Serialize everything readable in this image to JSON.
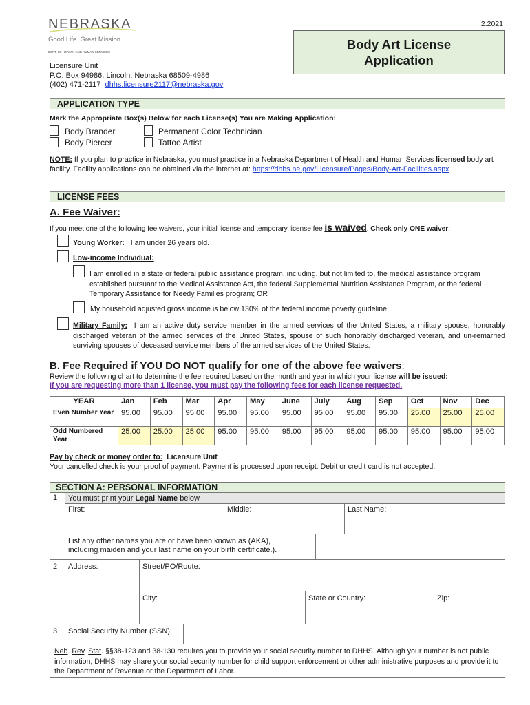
{
  "header": {
    "logo": {
      "word": "NEBRASKA",
      "tagline": "Good Life. Great Mission.",
      "dept": "DEPT. OF HEALTH AND HUMAN SERVICES"
    },
    "version": "2.2021",
    "title_line1": "Body Art License",
    "title_line2": "Application",
    "address": {
      "unit": "Licensure Unit",
      "po": "P.O. Box 94986, Lincoln, Nebraska 68509-4986",
      "phone": "(402) 471-2117",
      "email": "dhhs.licensure2117@nebraska.gov"
    },
    "colors": {
      "section_bg": "#e2efda",
      "highlight": "#fffbc7",
      "link": "#1f3fd6",
      "purple": "#7030a0"
    }
  },
  "application_type": {
    "heading": "APPLICATION TYPE",
    "instruction": "Mark the Appropriate Box(s) Below for each License(s) You are Making Application:",
    "options": [
      {
        "label": "Body Brander",
        "checked": false
      },
      {
        "label": "Body Piercer",
        "checked": false
      },
      {
        "label": "Permanent Color Technician",
        "checked": false
      },
      {
        "label": "Tattoo Artist",
        "checked": false
      }
    ],
    "note_label": "NOTE:",
    "note_text1": " If you plan to practice in Nebraska, you must practice in a Nebraska Department of Health and Human Services ",
    "note_bold": "licensed",
    "note_text2": " body art facility.  Facility applications can be obtained via the internet at:  ",
    "note_link": "https://dhhs.ne.gov/Licensure/Pages/Body-Art-Facilities.aspx"
  },
  "license_fees": {
    "heading": "LICENSE FEES",
    "waiver": {
      "title": "A.  Fee Waiver:",
      "intro": "If you meet one of the following fee waivers, your initial license and temporary license fee ",
      "intro_emph": "is waived",
      "intro_end": ".  ",
      "intro_bold": "Check only ONE waiver",
      "intro_colon": ":",
      "young_label": "Young Worker:",
      "young_text": "I am under 26 years old.",
      "low_income_label": "Low-income Individual:",
      "low_income_opt1": "I am enrolled in a state or federal public assistance program, including, but not limited to, the medical assistance program established pursuant to the Medical Assistance Act, the federal Supplemental Nutrition Assistance Program, or the federal Temporary Assistance for Needy Families program; OR",
      "low_income_opt2": "My household adjusted gross income is below 130% of the federal income poverty guideline.",
      "military_label": "Military Family:",
      "military_text": "I am an active duty service member in the armed services of the United States, a military spouse, honorably discharged veteran of the armed services of the United States, spouse of such honorably discharged veteran, and un-remarried surviving spouses of deceased service members of the armed services of the United States."
    },
    "fee_required": {
      "title": "B.  Fee Required if YOU DO NOT qualify for one of the above fee waivers",
      "title_colon": ":",
      "review": "Review the following chart to determine the fee required based on the month and year in which your license ",
      "review_bold": "will be issued:",
      "purple_note": "If you are requesting more than 1 license, you must pay the following fees for each license requested."
    },
    "table": {
      "year_header": "YEAR",
      "months": [
        "Jan",
        "Feb",
        "Mar",
        "Apr",
        "May",
        "June",
        "July",
        "Aug",
        "Sep",
        "Oct",
        "Nov",
        "Dec"
      ],
      "rows": [
        {
          "label": "Even Number Year",
          "values": [
            "95.00",
            "95.00",
            "95.00",
            "95.00",
            "95.00",
            "95.00",
            "95.00",
            "95.00",
            "95.00",
            "25.00",
            "25.00",
            "25.00"
          ]
        },
        {
          "label": "Odd Numbered Year",
          "values": [
            "25.00",
            "25.00",
            "25.00",
            "95.00",
            "95.00",
            "95.00",
            "95.00",
            "95.00",
            "95.00",
            "95.00",
            "95.00",
            "95.00"
          ]
        }
      ]
    },
    "pay_label": "Pay by check or money order to:",
    "pay_to": "Licensure Unit",
    "pay_note": "Your cancelled check is your proof of payment.  Payment is processed upon receipt.  Debit or credit card is not accepted."
  },
  "section_a": {
    "heading": "SECTION A:  PERSONAL INFORMATION",
    "row1_num": "1",
    "legal_name_pre": "You must print your ",
    "legal_name_bold": "Legal Name",
    "legal_name_post": " below",
    "first": "First:",
    "middle": "Middle:",
    "last": "Last Name:",
    "aka_line1": "List any other names you are or have been known as (AKA),",
    "aka_line2": "including maiden and your last name on your birth certificate.).",
    "row2_num": "2",
    "address": "Address:",
    "street": "Street/PO/Route:",
    "city": "City:",
    "state": "State or Country:",
    "zip": "Zip:",
    "row3_num": "3",
    "ssn": "Social Security Number (SSN):",
    "statute_neb": "Neb",
    "statute_rev": "Rev",
    "statute_stat": "Stat",
    "statute_text": " §§38-123 and 38-130 requires you to provide your social security number to DHHS.  Although your number is not public information, DHHS may share your social security number for child support enforcement or other administrative purposes and provide it to the Department of Revenue or the Department of Labor."
  }
}
